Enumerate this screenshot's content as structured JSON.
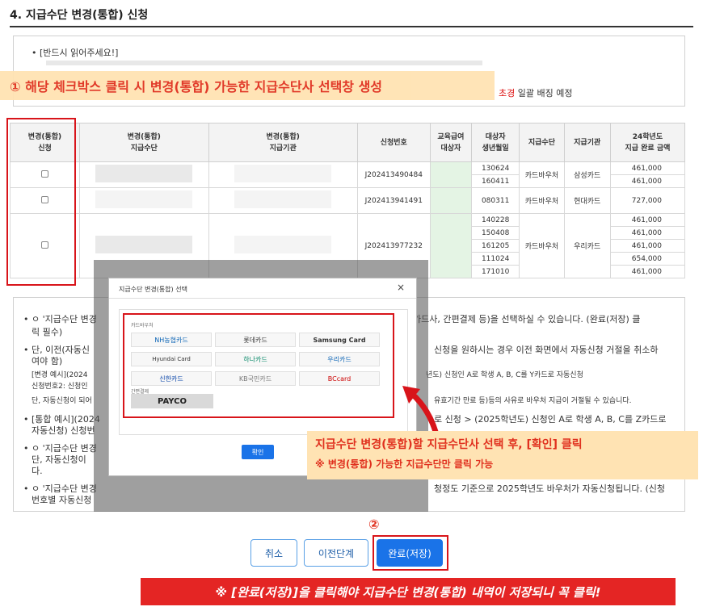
{
  "section_title": "4. 지급수단 변경(통합) 신청",
  "notice": {
    "line1": "• [반드시 읽어주세요!]",
    "tail_red": "초경",
    "tail_rest": " 일괄 배징 예정"
  },
  "annotation1": "① 해당 체크박스 클릭 시 변경(통합) 가능한 지급수단사 선택창 생성",
  "table": {
    "headers": [
      "변경(통합)\n신청",
      "변경(통합)\n지급수단",
      "변경(통합)\n지급기관",
      "신청번호",
      "교육급여\n대상자",
      "대상자\n생년월일",
      "지급수단",
      "지급기관",
      "24학년도\n지급 완료 금액"
    ],
    "groups": [
      {
        "app_no": "J202413490484",
        "method": "카드바우처",
        "org": "삼성카드",
        "rows": [
          {
            "birth": "130624",
            "amount": "461,000"
          },
          {
            "birth": "160411",
            "amount": "461,000"
          }
        ]
      },
      {
        "app_no": "J202413941491",
        "method": "카드바우처",
        "org": "현대카드",
        "rows": [
          {
            "birth": "080311",
            "amount": "727,000"
          }
        ]
      },
      {
        "app_no": "J202413977232",
        "method": "카드바우처",
        "org": "우리카드",
        "rows": [
          {
            "birth": "140228",
            "amount": "461,000"
          },
          {
            "birth": "150408",
            "amount": "461,000"
          },
          {
            "birth": "161205",
            "amount": "461,000"
          },
          {
            "birth": "111024",
            "amount": "654,000"
          },
          {
            "birth": "171010",
            "amount": "461,000"
          }
        ]
      }
    ]
  },
  "lower_notice": {
    "l1": "• ㅇ '지급수단 변경",
    "l1_right": "카드사, 간편결제 등)을 선택하실 수 있습니다. (완료(저장) 클",
    "l1b": "릭 필수)",
    "l2": "• 단, 이전(자동신",
    "l2_right": "신청을 원하시는 경우 이전 화면에서 자동신청 거절을 취소하",
    "l2b": "여야 함)",
    "l3": "[변경 예시](2024",
    "l3_right": "년도) 신청인 A로 학생 A, B, C를 Y카드로 자동신청",
    "l3b": "신청번호2: 신청인",
    "l4": "단, 자동신청이 되어",
    "l4_right": "유효기간 만료 등)등의 사유로 바우처 지급이 거절될 수 있습니다.",
    "l5": "• [통합 예시](2024",
    "l5_right": "로 신청 > (2025학년도) 신청인 A로 학생 A, B, C를 Z카드로",
    "l5b": "자동신청) 신청번",
    "l6": "• ㅇ '지급수단 변경",
    "l6b": "단, 자동신청이",
    "l6c": "다.",
    "l7": "• ㅇ '지급수단 변경",
    "l7_right": "청정도 기준으로 2025학년도 바우처가 자동신청됩니다. (신청",
    "l7b": "번호별 자동신청"
  },
  "dialog": {
    "title": "지급수단 변경(통합) 선택",
    "close": "×",
    "section_card": "카드바우처",
    "section_easy": "간편결제",
    "cards": [
      "NH농협카드",
      "롯데카드",
      "Samsung Card",
      "Hyundai Card",
      "하나카드",
      "우리카드",
      "신한카드",
      "KB국민카드",
      "BCcard"
    ],
    "payco": "PAYCO",
    "confirm": "확인"
  },
  "annotation2": {
    "line1": "지급수단 변경(통합)할 지급수단사 선택 후, [확인] 클릭",
    "line2": "※ 변경(통합) 가능한 지급수단만 클릭 가능"
  },
  "buttons": {
    "circle2": "②",
    "cancel": "취소",
    "prev": "이전단계",
    "done": "완료(저장)"
  },
  "banner": "※ [완료(저장)]을 클릭해야 지급수단 변경(통합) 내역이 저장되니 꼭 클릭!",
  "colors": {
    "accent_red": "#d8141a",
    "blue": "#1a73e8",
    "highlight": "#ffe3b3"
  }
}
